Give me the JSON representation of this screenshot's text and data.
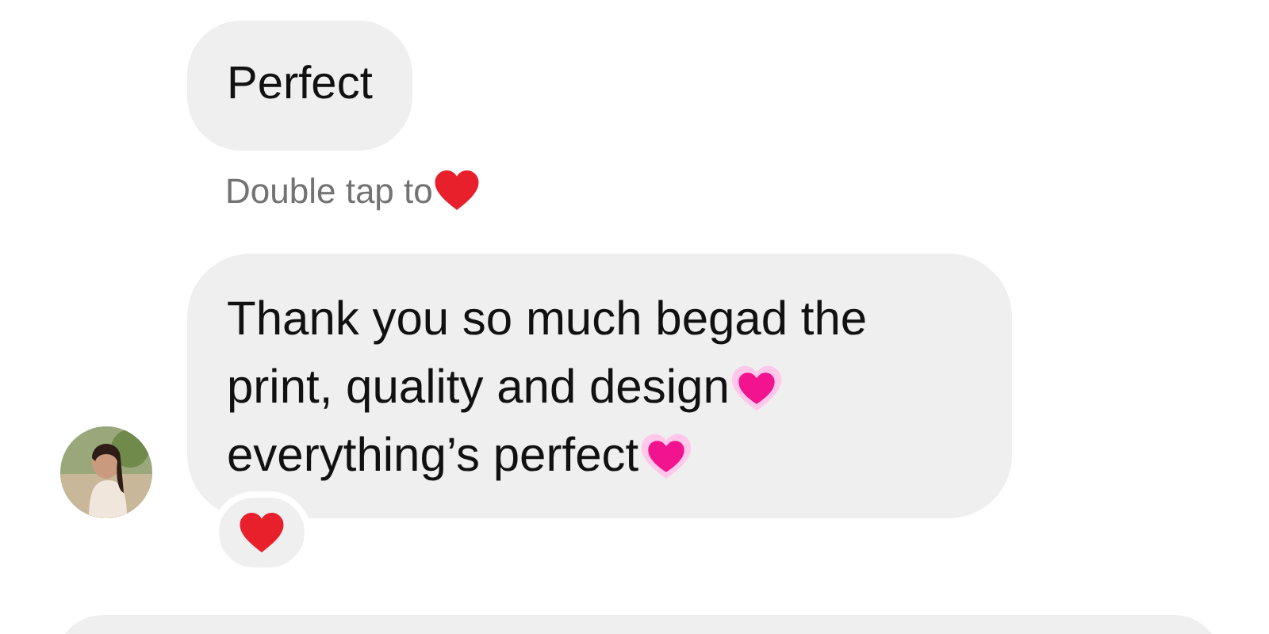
{
  "messages": [
    {
      "kind": "plain",
      "lines": [
        {
          "text": "Perfect"
        }
      ],
      "hint": {
        "text": "Double tap to",
        "emoji": {
          "kind": "red_heart"
        }
      }
    },
    {
      "kind": "avatar",
      "lines": [
        {
          "text": "Thank you so much begad the"
        },
        {
          "text": "print, quality and design",
          "emoji": {
            "kind": "pink_heart"
          }
        },
        {
          "text": "everything’s perfect",
          "emoji": {
            "kind": "pink_heart"
          }
        }
      ],
      "reaction": {
        "kind": "red_heart"
      }
    },
    {
      "kind": "cut"
    }
  ]
}
